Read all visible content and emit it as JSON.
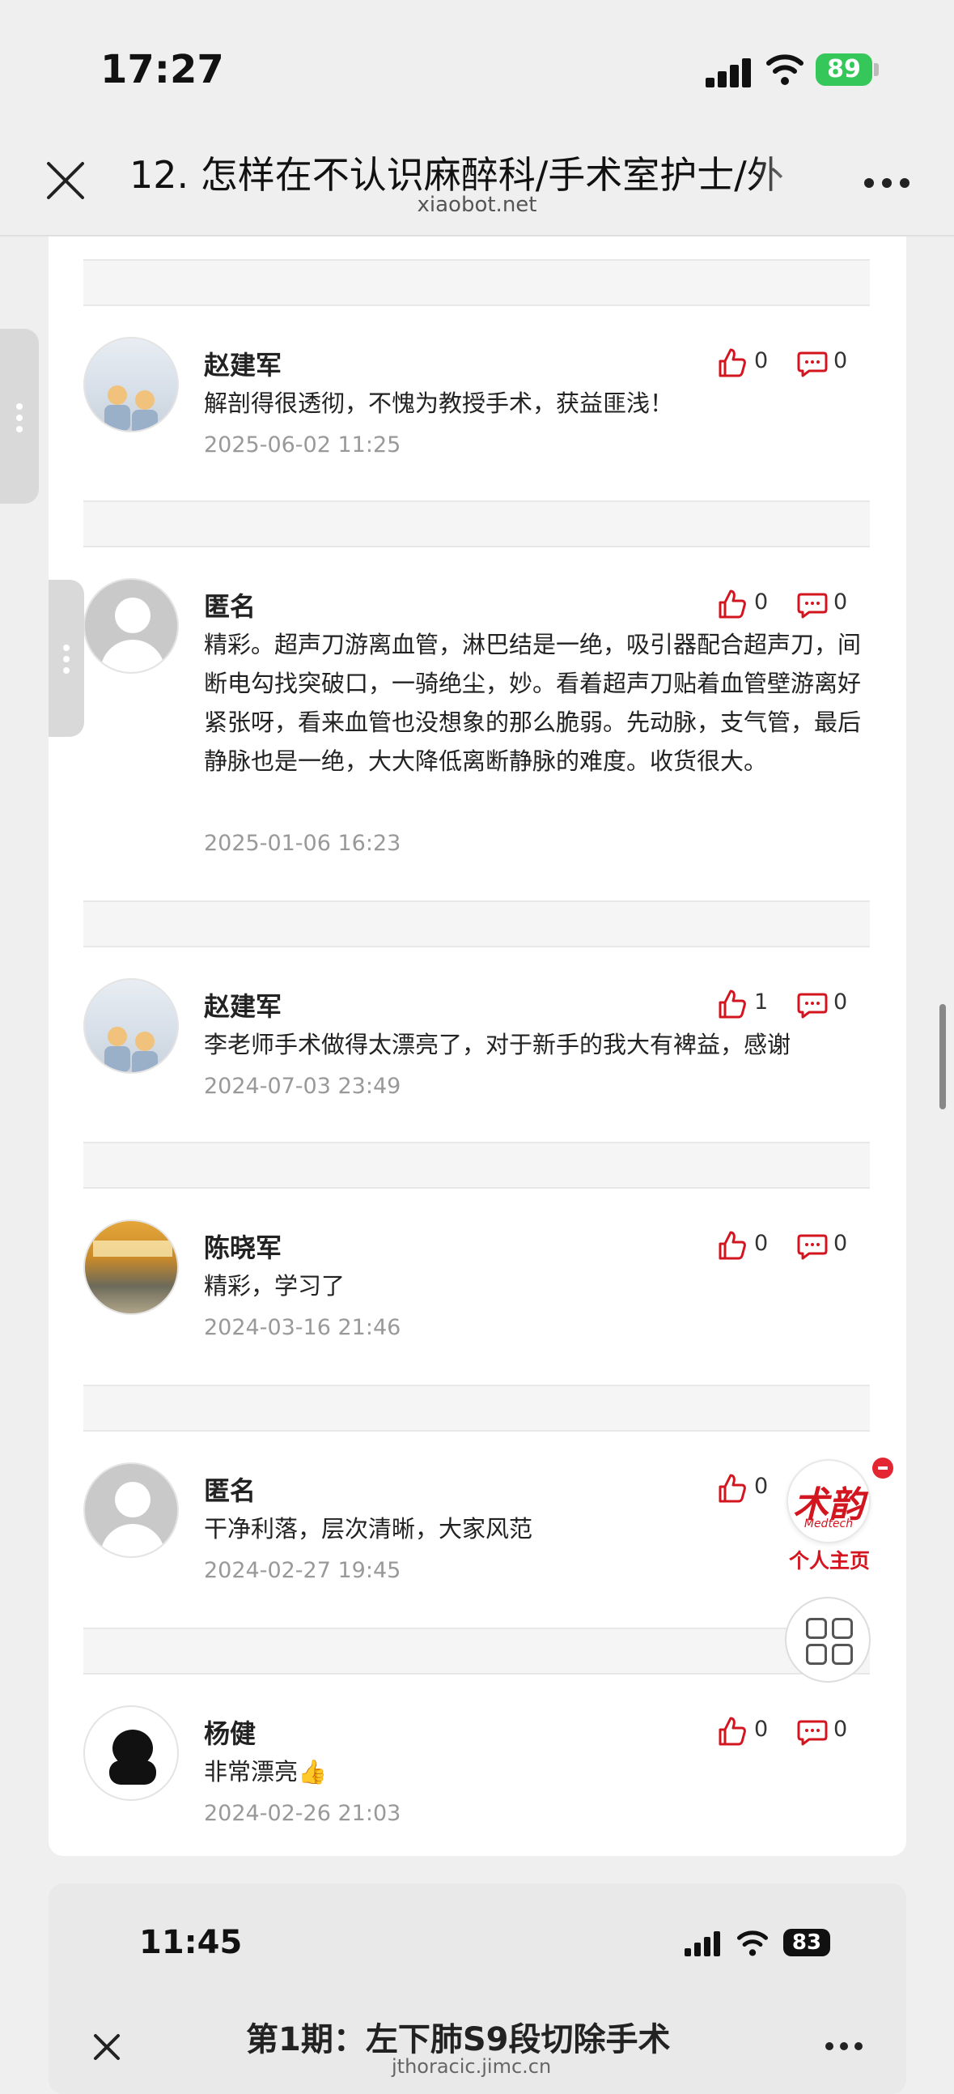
{
  "status_bar": {
    "time": "17:27",
    "battery": "89"
  },
  "header": {
    "title": "12. 怎样在不认识麻醉科/手术室护士/外",
    "url": "xiaobot.net"
  },
  "comments": [
    {
      "name": "赵建军",
      "text": "解剖得很透彻，不愧为教授手术，获益匪浅！",
      "date": "2025-06-02 11:25",
      "likes": "0",
      "replies": "0"
    },
    {
      "name": "匿名",
      "text": "精彩。超声刀游离血管，淋巴结是一绝，吸引器配合超声刀，间断电勾找突破口，一骑绝尘，妙。看着超声刀贴着血管壁游离好紧张呀，看来血管也没想象的那么脆弱。先动脉，支气管，最后静脉也是一绝，大大降低离断静脉的难度。收货很大。",
      "date": "2025-01-06 16:23",
      "likes": "0",
      "replies": "0"
    },
    {
      "name": "赵建军",
      "text": "李老师手术做得太漂亮了，对于新手的我大有裨益，感谢",
      "date": "2024-07-03 23:49",
      "likes": "1",
      "replies": "0"
    },
    {
      "name": "陈晓军",
      "text": "精彩，学习了",
      "date": "2024-03-16 21:46",
      "likes": "0",
      "replies": "0"
    },
    {
      "name": "匿名",
      "text": "干净利落，层次清晰，大家风范",
      "date": "2024-02-27 19:45",
      "likes": "0",
      "replies": ""
    },
    {
      "name": "杨健",
      "text": "非常漂亮👍",
      "date": "2024-02-26 21:03",
      "likes": "0",
      "replies": "0"
    }
  ],
  "floating": {
    "brand": "术韵",
    "brand_sub": "Medtech",
    "personal_label": "个人主页"
  },
  "second_screen": {
    "time": "11:45",
    "battery": "83",
    "title": "第1期：左下肺S9段切除手术",
    "url": "jthoracic.jimc.cn"
  },
  "colors": {
    "accent": "#d3151f",
    "background": "#efefef"
  }
}
